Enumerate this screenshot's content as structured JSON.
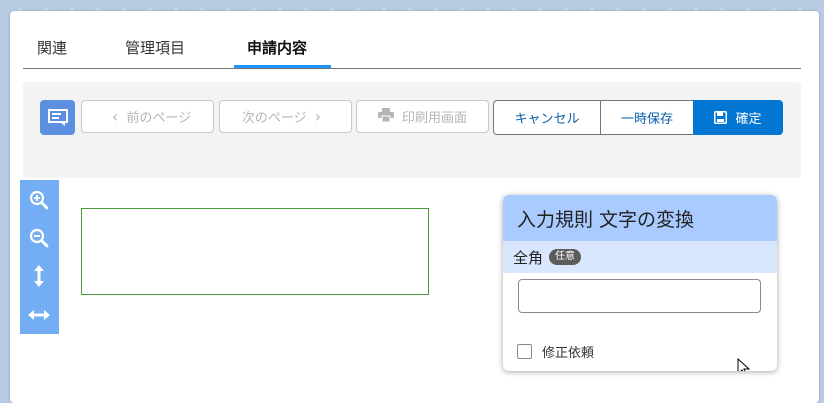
{
  "tabs": [
    {
      "label": "関連"
    },
    {
      "label": "管理項目"
    },
    {
      "label": "申請内容",
      "active": true
    }
  ],
  "toolbar": {
    "prev_label": "前のページ",
    "next_label": "次のページ",
    "print_label": "印刷用画面",
    "cancel_label": "キャンセル",
    "save_label": "一時保存",
    "confirm_label": "確定"
  },
  "zoom_tools": [
    "zoom-in-icon",
    "zoom-out-icon",
    "fit-height-icon",
    "fit-width-icon"
  ],
  "popup": {
    "title": "入力規則 文字の変換",
    "field_label": "全角",
    "badge": "任意",
    "input_value": "",
    "checkbox_label": "修正依頼"
  },
  "colors": {
    "primary": "#0176d3",
    "tab_active": "#1b96ff",
    "popup_header": "#aacbff",
    "popup_sub": "#d8e6fe",
    "zoom_bar": "#73aef5"
  }
}
